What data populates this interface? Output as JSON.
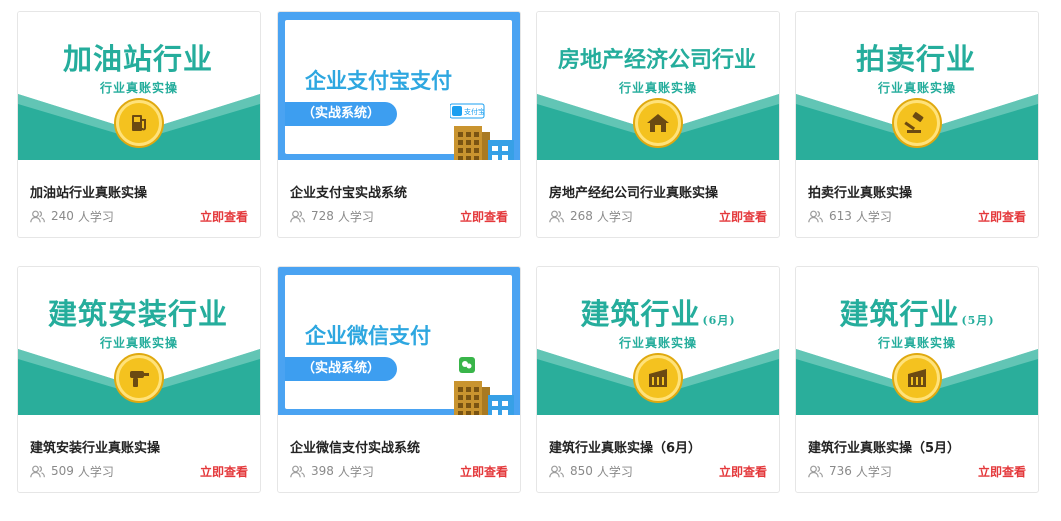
{
  "colors": {
    "teal": "#25ad9c",
    "badge": "#f4c21f",
    "payment_blue": "#4aa3f2",
    "link_red": "#e4393c"
  },
  "cards": [
    {
      "title": "加油站行业真账实操",
      "count": "240",
      "unit": "人学习",
      "action": "立即查看",
      "banner": {
        "type": "industry",
        "title": "加油站行业",
        "suffix": "",
        "subtitle": "行业真账实操",
        "icon": "gas-pump-icon"
      }
    },
    {
      "title": "企业支付宝实战系统",
      "count": "728",
      "unit": "人学习",
      "action": "立即查看",
      "banner": {
        "type": "payment",
        "title": "企业支付宝支付",
        "pill": "（实战系统）",
        "icon": "alipay-icon",
        "logo_text": "支付宝"
      }
    },
    {
      "title": "房地产经纪公司行业真账实操",
      "count": "268",
      "unit": "人学习",
      "action": "立即查看",
      "banner": {
        "type": "industry",
        "title": "房地产经济公司行业",
        "suffix": "",
        "subtitle": "行业真账实操",
        "icon": "house-icon"
      }
    },
    {
      "title": "拍卖行业真账实操",
      "count": "613",
      "unit": "人学习",
      "action": "立即查看",
      "banner": {
        "type": "industry",
        "title": "拍卖行业",
        "suffix": "",
        "subtitle": "行业真账实操",
        "icon": "gavel-icon"
      }
    },
    {
      "title": "建筑安装行业真账实操",
      "count": "509",
      "unit": "人学习",
      "action": "立即查看",
      "banner": {
        "type": "industry",
        "title": "建筑安装行业",
        "suffix": "",
        "subtitle": "行业真账实操",
        "icon": "drill-icon"
      }
    },
    {
      "title": "企业微信支付实战系统",
      "count": "398",
      "unit": "人学习",
      "action": "立即查看",
      "banner": {
        "type": "payment",
        "title": "企业微信支付",
        "pill": "（实战系统）",
        "icon": "wechat-icon",
        "logo_text": ""
      }
    },
    {
      "title": "建筑行业真账实操（6月）",
      "count": "850",
      "unit": "人学习",
      "action": "立即查看",
      "banner": {
        "type": "industry",
        "title": "建筑行业",
        "suffix": "(6月)",
        "subtitle": "行业真账实操",
        "icon": "building-icon"
      }
    },
    {
      "title": "建筑行业真账实操（5月）",
      "count": "736",
      "unit": "人学习",
      "action": "立即查看",
      "banner": {
        "type": "industry",
        "title": "建筑行业",
        "suffix": "(5月)",
        "subtitle": "行业真账实操",
        "icon": "building-icon"
      }
    }
  ]
}
